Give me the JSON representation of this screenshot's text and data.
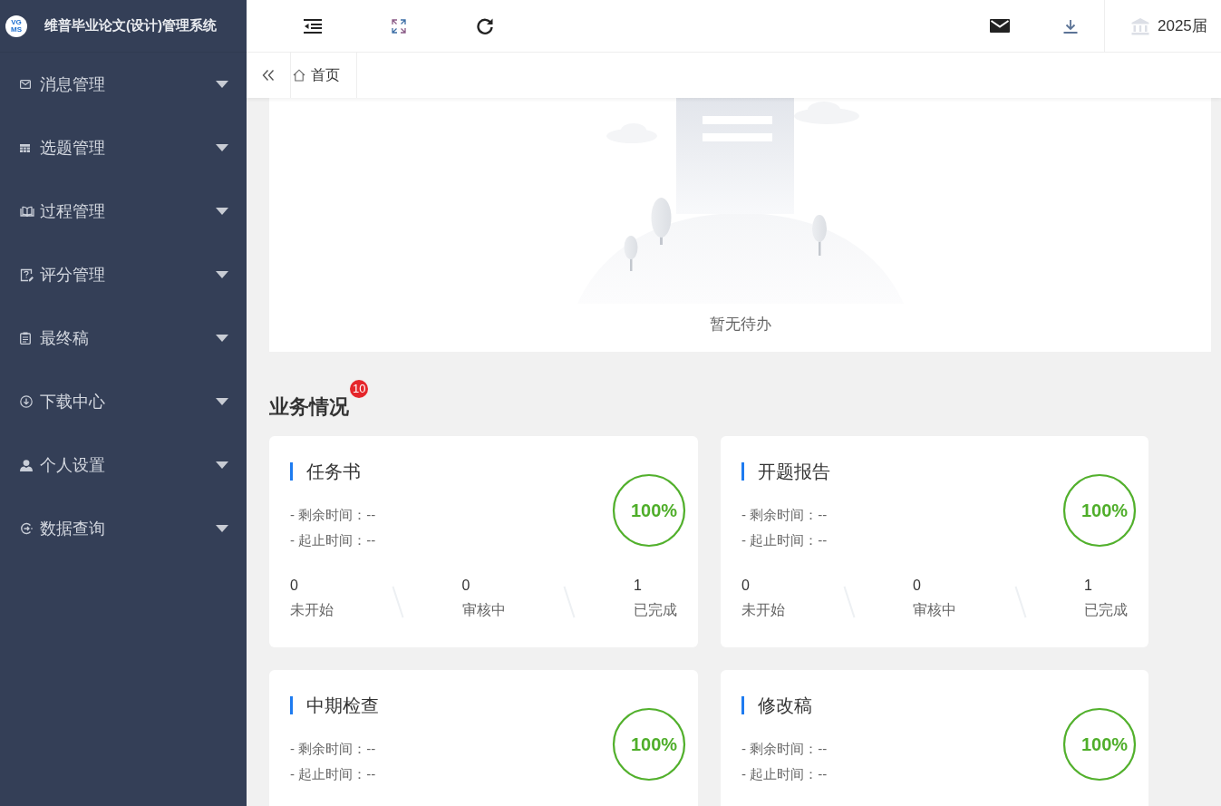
{
  "app": {
    "logo": [
      "VG",
      "MS"
    ],
    "title": "维普毕业论文(设计)管理系统"
  },
  "sidebar": {
    "items": [
      {
        "label": "消息管理",
        "expanded": false
      },
      {
        "label": "选题管理",
        "expanded": false
      },
      {
        "label": "过程管理",
        "expanded": false
      },
      {
        "label": "评分管理",
        "expanded": false
      },
      {
        "label": "最终稿",
        "expanded": false
      },
      {
        "label": "下载中心",
        "expanded": false
      },
      {
        "label": "个人设置",
        "expanded": false
      },
      {
        "label": "数据查询",
        "expanded": false
      }
    ]
  },
  "header": {
    "year_selector": "2025届"
  },
  "tabs": [
    {
      "label": "首页",
      "selected": true
    }
  ],
  "todo": {
    "message": "暂无待办"
  },
  "business": {
    "title": "业务情况",
    "badge": "10",
    "cards": [
      {
        "title": "任务书",
        "lines": [
          "- 剩余时间：--",
          "- 起止时间：--"
        ],
        "percent": "100%",
        "level": 1,
        "stats": [
          {
            "value": "0",
            "label": "未开始"
          },
          {
            "value": "0",
            "label": "审核中"
          },
          {
            "value": "1",
            "label": "已完成"
          }
        ]
      },
      {
        "title": "开题报告",
        "lines": [
          "- 剩余时间：--",
          "- 起止时间：--"
        ],
        "percent": "100%",
        "level": 1,
        "stats": [
          {
            "value": "0",
            "label": "未开始"
          },
          {
            "value": "0",
            "label": "审核中"
          },
          {
            "value": "1",
            "label": "已完成"
          }
        ]
      },
      {
        "title": "中期检查",
        "lines": [
          "- 剩余时间：--",
          "- 起止时间：--"
        ],
        "percent": "100%",
        "level": 1
      },
      {
        "title": "修改稿",
        "lines": [
          "- 剩余时间：--",
          "- 起止时间：--"
        ],
        "percent": "100%",
        "level": 1
      }
    ]
  }
}
